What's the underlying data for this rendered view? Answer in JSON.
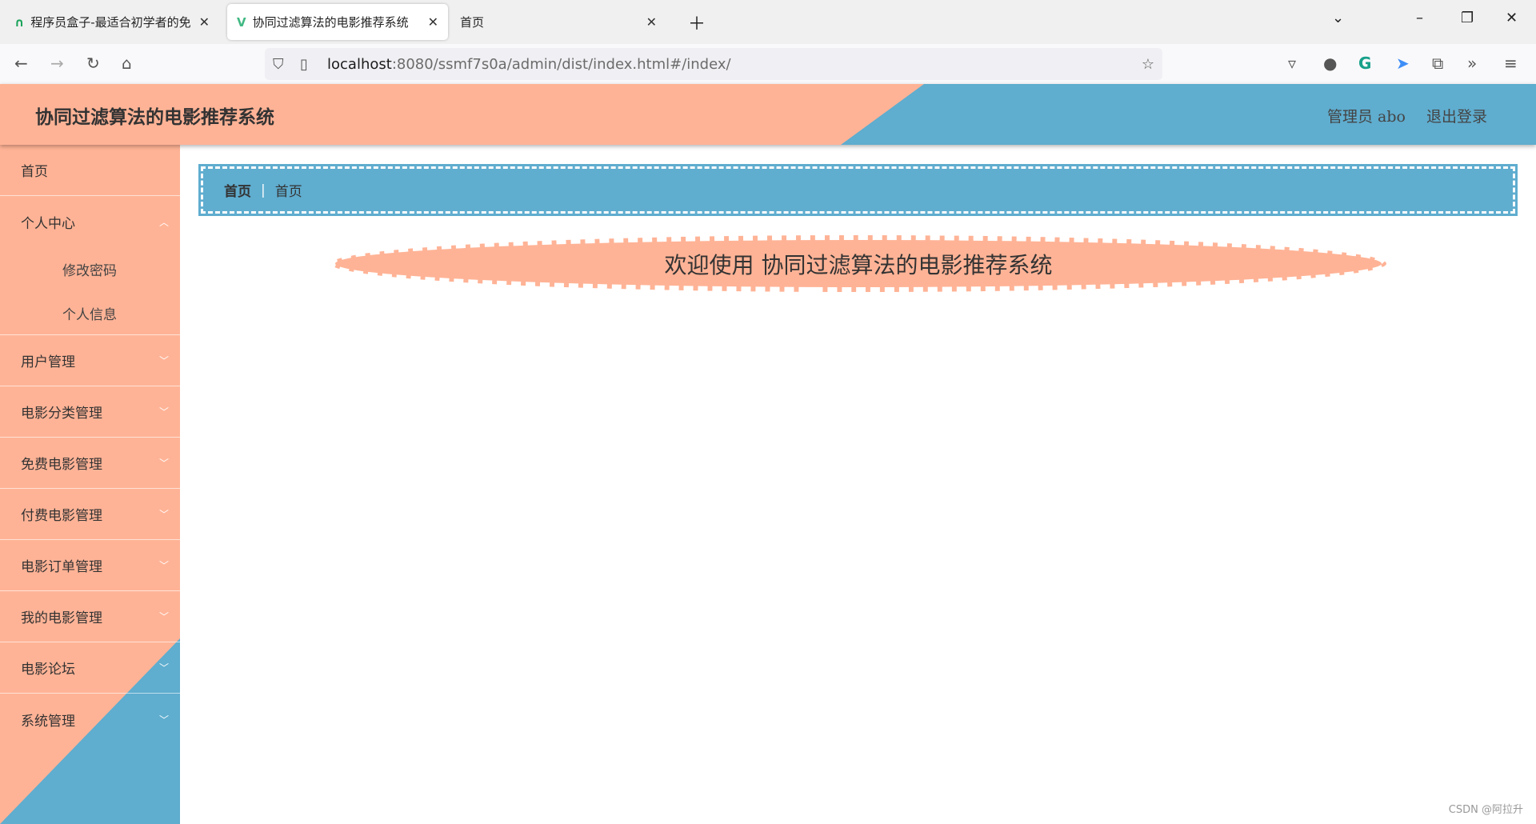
{
  "browser": {
    "tabs": [
      {
        "label": "程序员盒子-最适合初学者的免"
      },
      {
        "label": "协同过滤算法的电影推荐系统",
        "active": true
      },
      {
        "label": "首页"
      }
    ],
    "url_host": "localhost",
    "url_rest": ":8080/ssmf7s0a/admin/dist/index.html#/index/"
  },
  "header": {
    "title": "协同过滤算法的电影推荐系统",
    "user": "管理员 abo",
    "logout": "退出登录"
  },
  "sidebar": {
    "items": [
      {
        "label": "首页"
      },
      {
        "label": "个人中心",
        "children": [
          "修改密码",
          "个人信息"
        ]
      },
      {
        "label": "用户管理"
      },
      {
        "label": "电影分类管理"
      },
      {
        "label": "免费电影管理"
      },
      {
        "label": "付费电影管理"
      },
      {
        "label": "电影订单管理"
      },
      {
        "label": "我的电影管理"
      },
      {
        "label": "电影论坛"
      },
      {
        "label": "系统管理"
      }
    ]
  },
  "breadcrumb": [
    "首页",
    "首页"
  ],
  "welcome": "欢迎使用 协同过滤算法的电影推荐系统",
  "watermark": "CSDN @阿拉升",
  "colors": {
    "primary": "#ffb396",
    "secondary": "#5fadcf"
  }
}
